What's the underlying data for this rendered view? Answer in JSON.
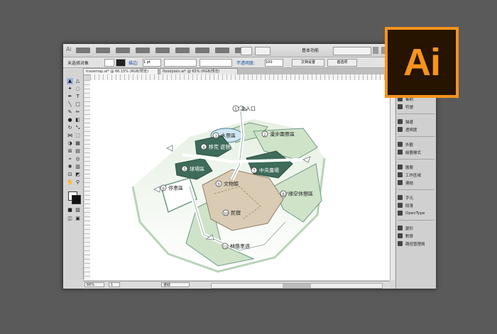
{
  "app_logo": {
    "text": "Ai",
    "bg_color": "#261300",
    "accent_color": "#f7931e"
  },
  "menubar": {
    "app_icon": "Ai",
    "workspace": "基本功能",
    "search_placeholder": ""
  },
  "control_bar": {
    "selection_label": "未选择对象",
    "stroke_label": "描边:",
    "stroke_value": "1 pt",
    "opacity_label": "不透明度:",
    "opacity_value": "100",
    "doc_setup_label": "文档设置",
    "prefs_label": "首选项"
  },
  "tabs": [
    {
      "label": "travemap.ai* @ 66.15% (RGB/预览)"
    },
    {
      "label": "floodplain.ai* @ 65% (RGB/预览)"
    }
  ],
  "map": {
    "labels": [
      {
        "num": "1",
        "text": "主入口"
      },
      {
        "num": "2",
        "text": "漫步園景區"
      },
      {
        "num": "3",
        "text": "水景區"
      },
      {
        "num": "4",
        "text": "移荒 遊憩區"
      },
      {
        "num": "5",
        "text": "球場區"
      },
      {
        "num": "6",
        "text": "停車區"
      },
      {
        "num": "7",
        "text": "中央廣場"
      },
      {
        "num": "8",
        "text": "綠空休憩區"
      },
      {
        "num": "9",
        "text": "文物館"
      },
      {
        "num": "10",
        "text": "民宿"
      },
      {
        "num": "11",
        "text": "林蔭車道"
      }
    ],
    "colors": {
      "dark_green": "#3f6b5b",
      "light_green": "#cfe3c9",
      "sand": "#d9cbb4",
      "water": "#cfe6f2"
    }
  },
  "status_bar": {
    "zoom": "66%",
    "page": "1",
    "tool": "選取"
  },
  "panels": [
    {
      "label": "顏色",
      "icon": "color-icon"
    },
    {
      "label": "色票",
      "icon": "swatches-icon"
    },
    {
      "label": "筆刷",
      "icon": "brushes-icon"
    },
    {
      "label": "符號",
      "icon": "symbols-icon"
    },
    {
      "label": "描邊",
      "icon": "stroke-icon"
    },
    {
      "label": "透明度",
      "icon": "transparency-icon"
    },
    {
      "label": "外觀",
      "icon": "appearance-icon"
    },
    {
      "label": "繪圖樣式",
      "icon": "graphic-styles-icon"
    },
    {
      "label": "圖層",
      "icon": "layers-icon"
    },
    {
      "label": "工作區域",
      "icon": "artboards-icon"
    },
    {
      "label": "連結",
      "icon": "links-icon"
    },
    {
      "label": "字元",
      "icon": "character-icon"
    },
    {
      "label": "段落",
      "icon": "paragraph-icon"
    },
    {
      "label": "OpenType",
      "icon": "opentype-icon"
    },
    {
      "label": "變形",
      "icon": "transform-icon"
    },
    {
      "label": "對齊",
      "icon": "align-icon"
    },
    {
      "label": "路徑管理員",
      "icon": "pathfinder-icon"
    }
  ]
}
